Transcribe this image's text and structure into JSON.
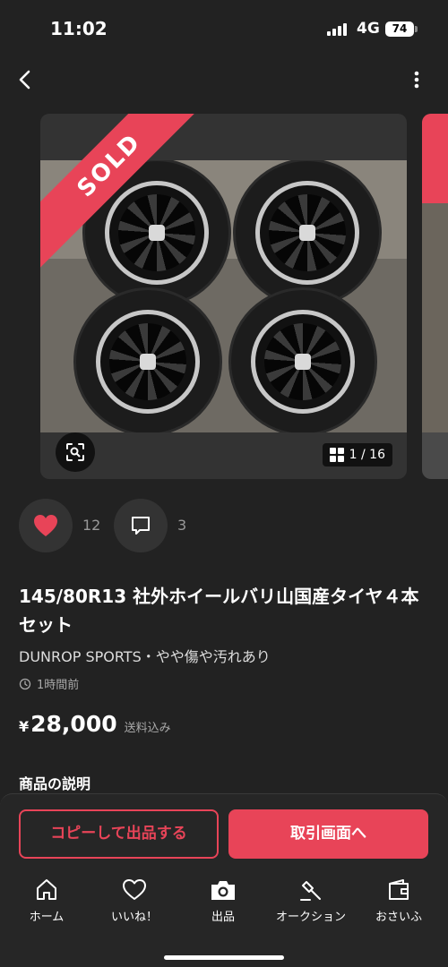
{
  "status_bar": {
    "time": "11:02",
    "network": "4G",
    "battery": "74"
  },
  "listing": {
    "sold_label": "SOLD",
    "photo_counter": "1 / 16",
    "likes": "12",
    "comments": "3",
    "title": "145/80R13 社外ホイールバリ山国産タイヤ４本セット",
    "subtitle": "DUNROP SPORTS・やや傷や汚れあり",
    "posted": "1時間前",
    "price_symbol": "¥",
    "price": "28,000",
    "shipping": "送料込み",
    "description_heading": "商品の説明"
  },
  "actions": {
    "copy_label": "コピーして出品する",
    "trade_label": "取引画面へ"
  },
  "tabs": [
    {
      "label": "ホーム",
      "icon": "home-icon"
    },
    {
      "label": "いいね！",
      "icon": "heart-outline-icon"
    },
    {
      "label": "出品",
      "icon": "camera-icon"
    },
    {
      "label": "オークション",
      "icon": "gavel-icon"
    },
    {
      "label": "おさいふ",
      "icon": "wallet-icon"
    }
  ],
  "colors": {
    "accent": "#e84458",
    "background": "#222222"
  }
}
